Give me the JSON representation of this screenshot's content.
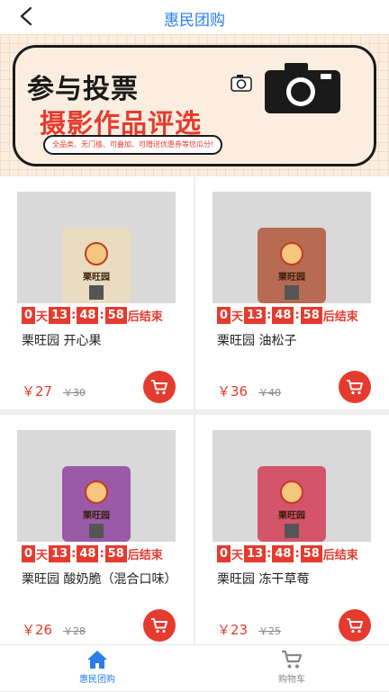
{
  "header": {
    "title": "惠民团购",
    "back_icon": "chevron-left-icon"
  },
  "banner": {
    "line1": "参与投票",
    "line2": "摄影作品评选",
    "subtitle": "全品类、无门槛、可叠加、可赠送优惠券等您瓜分!",
    "icons": [
      "camera-icon",
      "camera-small-icon"
    ]
  },
  "countdown": {
    "days": "0",
    "day_label": "天",
    "hours": "13",
    "minutes": "48",
    "seconds": "58",
    "sep": ":",
    "suffix": "后结束"
  },
  "products": [
    {
      "name": "栗旺园 开心果",
      "price": "￥27",
      "original_price": "￥30",
      "bag_label": "栗旺园",
      "bag_color": "#e9dcc0"
    },
    {
      "name": "栗旺园 油松子",
      "price": "￥36",
      "original_price": "￥40",
      "bag_label": "栗旺园",
      "bag_color": "#b76b52"
    },
    {
      "name": "栗旺园 酸奶脆（混合口味）",
      "price": "￥26",
      "original_price": "￥28",
      "bag_label": "栗旺园",
      "bag_color": "#9a5aa8"
    },
    {
      "name": "栗旺园 冻干草莓",
      "price": "￥23",
      "original_price": "￥25",
      "bag_label": "栗旺园",
      "bag_color": "#d4546a"
    }
  ],
  "tabbar": {
    "tabs": [
      {
        "label": "惠民团购",
        "icon": "home-icon",
        "active": true
      },
      {
        "label": "购物车",
        "icon": "cart-icon",
        "active": false
      }
    ]
  },
  "colors": {
    "accent": "#2b7de9",
    "sale_red": "#e53b2f",
    "inactive": "#888888"
  }
}
